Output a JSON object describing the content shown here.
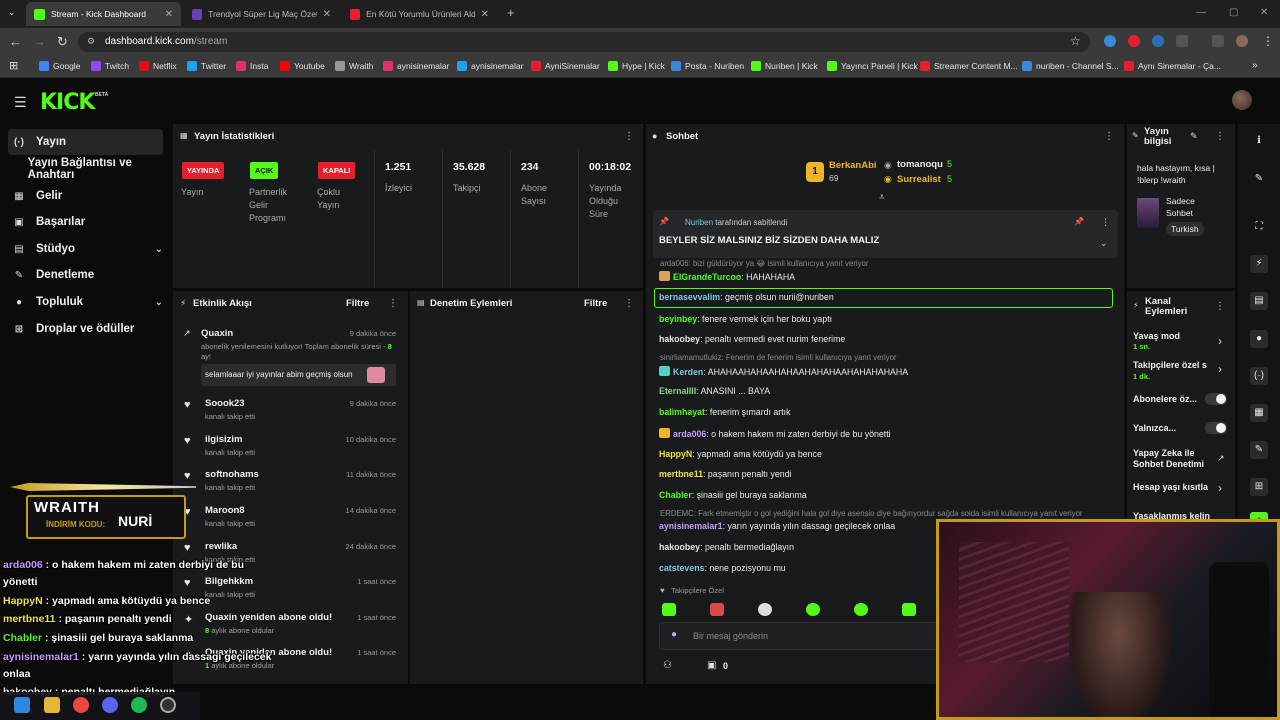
{
  "browser": {
    "tabs": [
      {
        "title": "Stream - Kick Dashboard",
        "active": true
      },
      {
        "title": "Trendyol Süper Lig Maç Özetler"
      },
      {
        "title": "En Kötü Yorumlu Ürünleri Aldım"
      }
    ],
    "new_tab": "+",
    "url_host": "dashboard.kick.com",
    "url_path": "/stream",
    "bookmarks": [
      "Google",
      "Twitch",
      "Netflix",
      "Twitter",
      "Insta",
      "Youtube",
      "Wraith",
      "aynisinemalar",
      "aynisinemalar",
      "AyniSinemalar",
      "Hype | Kick",
      "Posta - Nuriben",
      "Nuriben | Kick",
      "Yayıncı Paneli | Kick",
      "Streamer Content M...",
      "nuriben - Channel S...",
      "Aynı Sinemalar - Ça..."
    ]
  },
  "app": {
    "logo": "KICK",
    "beta": "BETA"
  },
  "sidebar": {
    "items": [
      {
        "label": "Yayın",
        "icon": "(·)"
      },
      {
        "label": "Yayın Bağlantısı ve Anahtarı",
        "icon": ""
      },
      {
        "label": "Gelir",
        "icon": "▦"
      },
      {
        "label": "Başarılar",
        "icon": "▣"
      },
      {
        "label": "Stüdyo",
        "icon": "▤"
      },
      {
        "label": "Denetleme",
        "icon": "✎"
      },
      {
        "label": "Topluluk",
        "icon": "●"
      },
      {
        "label": "Droplar ve ödüller",
        "icon": "⊞"
      }
    ]
  },
  "stats": {
    "title": "Yayın İstatistikleri",
    "badges": [
      {
        "text": "YAYINDA",
        "label": "Yayın",
        "color": "#e5202e",
        "fg": "#ffffff"
      },
      {
        "text": "AÇIK",
        "label": "Partnerlik Gelir Programı",
        "color": "#53fc18",
        "fg": "#0b0b0c"
      },
      {
        "text": "KAPALI",
        "label": "Çoklu Yayın",
        "color": "#e5202e",
        "fg": "#ffffff"
      }
    ],
    "numbers": [
      {
        "value": "1.251",
        "label": "İzleyici"
      },
      {
        "value": "35.628",
        "label": "Takipçi"
      },
      {
        "value": "234",
        "label": "Abone Sayısı"
      },
      {
        "value": "00:18:02",
        "label": "Yayında Olduğu Süre"
      }
    ]
  },
  "activity": {
    "title": "Etkinlik Akışı",
    "filter": "Filtre",
    "first": {
      "name": "Quaxin",
      "time": "9 dakika önce",
      "sub": "abonelik yenilemesini kutluyor! Toplam abonelik süresi - ",
      "months": "8",
      "months_suffix": " ay!",
      "message": "selamlaaar iyi yayınlar abim geçmiş olsun"
    },
    "events": [
      {
        "name": "Soook23",
        "sub": "kanalı takip etti",
        "time": "9 dakika önce"
      },
      {
        "name": "ilgisizim",
        "sub": "kanalı takip etti",
        "time": "10 dakika önce"
      },
      {
        "name": "softnohams",
        "sub": "kanalı takip etti",
        "time": "11 dakika önce"
      },
      {
        "name": "Maroon8",
        "sub": "kanalı takip etti",
        "time": "14 dakika önce"
      },
      {
        "name": "rewlika",
        "sub": "kanalı takip etti",
        "time": "24 dakika önce"
      },
      {
        "name": "Bilgehkkm",
        "sub": "kanalı takip etti",
        "time": "1 saat önce"
      }
    ],
    "resubs": [
      {
        "name": "Quaxin yeniden abone oldu!",
        "months": "8",
        "sub": " aylık abone oldular",
        "time": "1 saat önce"
      },
      {
        "name": "Quaxin yeniden abone oldu!",
        "months": "1",
        "sub": " aylık abone oldular",
        "time": "1 saat önce"
      }
    ]
  },
  "moderation": {
    "title": "Denetim Eylemleri",
    "filter": "Filtre"
  },
  "chat": {
    "title": "Sohbet",
    "top": [
      {
        "rank": "1",
        "name": "BerkanAbi",
        "count": "69"
      },
      {
        "name": "tomanoqu",
        "count": "5"
      },
      {
        "name": "Surrealist",
        "count": "5"
      }
    ],
    "pinned_by": "Nuriben",
    "pinned_suffix": "tarafından sabitlendi",
    "pinned_message": "BEYLER SİZ MALSINIZ BİZ SİZDEN DAHA MALIZ",
    "reply1": "arda006: bizi güldürüyor ya 😂 isimli kullanıcıya yanıt veriyor",
    "reply2": "sinirliamamutlukiz: Fenerim de fenerim isimli kullanıcıya yanıt veriyor",
    "reply3": "ERDEMC: Fark etmemiştir o gol yediğini hala gol diye asensio diye bağırıyordur sağda solda isimli kullanıcıya yanıt veriyor",
    "messages": [
      {
        "user": "ElGrandeTurcoo",
        "text": "HAHAHAHA",
        "color": "#53fc18"
      },
      {
        "user": "bernasevvalim",
        "text": "geçmiş olsun nurii@nuriben",
        "color": "#7ec8e3"
      },
      {
        "user": "beyinbey",
        "text": "fenere vermek için her boku yaptı",
        "color": "#53fc18"
      },
      {
        "user": "hakoobey",
        "text": "penaltı vermedi evet nurim fenerime",
        "color": "#e8e8e8"
      },
      {
        "user": "Kerden",
        "text": "AHAHAAHAHAAHAHAAHAHAHAAHAHAHAHAHA",
        "color": "#7ec8e3"
      },
      {
        "user": "EternalIII",
        "text": "ANASINI ... BAYA",
        "color": "#8bd28b"
      },
      {
        "user": "balimhayat",
        "text": "fenerim şımardı artık",
        "color": "#53fc18"
      },
      {
        "user": "arda006",
        "text": "o hakem hakem mi zaten derbiyi de bu yönetti",
        "color": "#c79bff"
      },
      {
        "user": "HappyN",
        "text": "yapmadı ama kötüydü ya bence",
        "color": "#f0e24a"
      },
      {
        "user": "mertbne11",
        "text": "paşanın penaltı yendi",
        "color": "#f0e24a"
      },
      {
        "user": "Chabler",
        "text": "şinasiii gel buraya saklanma",
        "color": "#53fc18"
      },
      {
        "user": "aynisinemalar1",
        "text": "yarın yayında yılın dassagı geçilecek onlaa",
        "color": "#c79bff"
      },
      {
        "user": "hakoobey",
        "text": "penaltı bermediağlayın",
        "color": "#e8e8e8"
      },
      {
        "user": "catstevens",
        "text": "nene pozisyonu mu",
        "color": "#7ec8e3"
      }
    ],
    "followers_only": "Takipçilere Özel",
    "input_placeholder": "Bir mesaj gönderin",
    "points": "0"
  },
  "stream_info": {
    "title": "Yayın bilgisi",
    "text": "hala hastayım, kısa | !blerp !wraith",
    "category": "Sadece Sohbet",
    "language": "Turkish"
  },
  "channel_actions": {
    "title": "Kanal Eylemleri",
    "slow_mode": "Yavaş mod",
    "slow_mode_value": "1 sn.",
    "followers": "Takipçilere özel s",
    "followers_value": "1 dk.",
    "subs": "Abonelere öz...",
    "alone": "Yalnızca...",
    "ai": "Yapay Zeka ile Sohbet Denetimi",
    "age": "Hesap yaşı kısıtla",
    "banned": "Yasaklanmış kelin"
  },
  "overlay": {
    "sponsor": "WRAITH",
    "code_label": "İNDİRİM KODU:",
    "code": "NURİ",
    "chat": [
      {
        "user": "arda006",
        "text": " : o hakem hakem mi zaten derbiyi de bu",
        "cont": "yönetti",
        "color": "#c79bff"
      },
      {
        "user": "HappyN",
        "text": " : yapmadı ama kötüydü ya bence",
        "color": "#f0e24a"
      },
      {
        "user": "mertbne11",
        "text": " : paşanın penaltı yendi",
        "color": "#f0e24a"
      },
      {
        "user": "Chabler",
        "text": " : şinasiii gel buraya saklanma",
        "color": "#53fc18"
      },
      {
        "user": "aynisinemalar1",
        "text": " : yarın yayında yılın dassagı geçilecek",
        "cont": "onlaa",
        "color": "#c79bff"
      },
      {
        "user": "hakoobey",
        "text": " : penaltı bermediağlayın",
        "color": "#e8e8e8"
      }
    ]
  }
}
